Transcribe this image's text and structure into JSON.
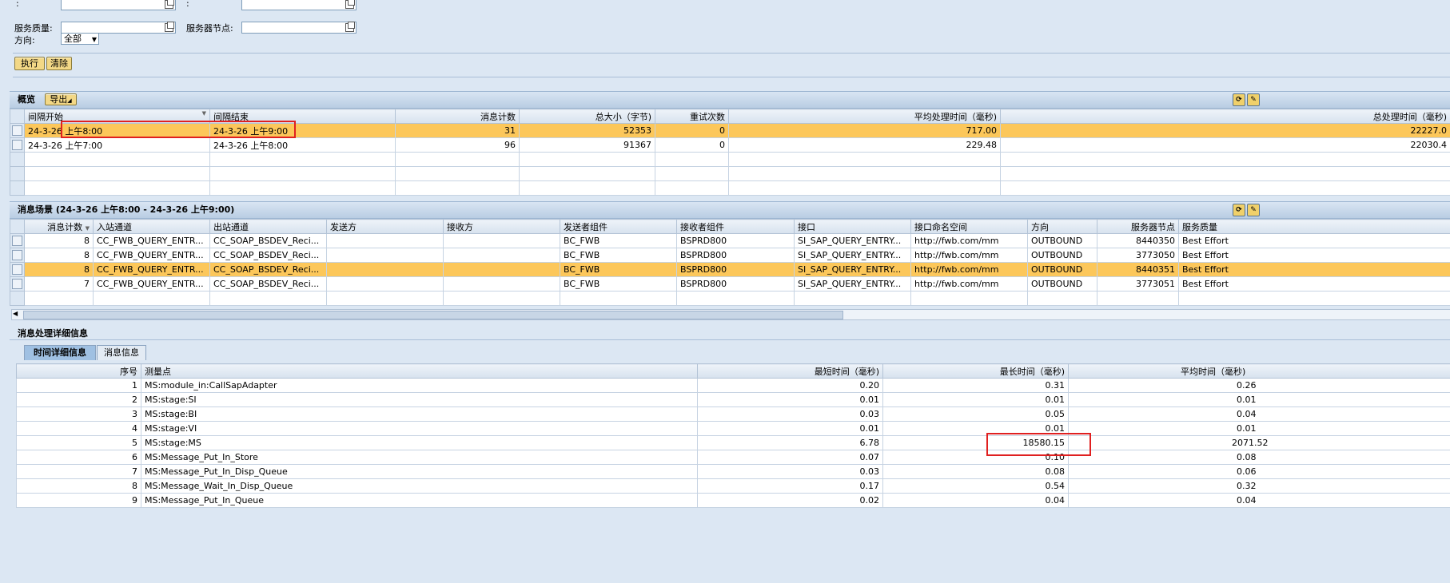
{
  "filter": {
    "row0_label_a": ":",
    "row0_label_b": ":",
    "service_quality_label": "服务质量:",
    "server_node_label": "服务器节点:",
    "direction_label": "方向:",
    "direction_value": "全部",
    "execute_button": "执行",
    "clear_button": "清除"
  },
  "overview": {
    "title": "概览",
    "export_button": "导出",
    "columns": [
      "间隔开始",
      "间隔结束",
      "消息计数",
      "总大小（字节)",
      "重试次数",
      "平均处理时间（毫秒)",
      "总处理时间（毫秒)"
    ],
    "rows": [
      [
        "24-3-26 上午8:00",
        "24-3-26 上午9:00",
        "31",
        "52353",
        "0",
        "717.00",
        "22227.0"
      ],
      [
        "24-3-26 上午7:00",
        "24-3-26 上午8:00",
        "96",
        "91367",
        "0",
        "229.48",
        "22030.4"
      ]
    ]
  },
  "scenario": {
    "title": "消息场景 (24-3-26 上午8:00 - 24-3-26 上午9:00)",
    "columns": [
      "消息计数",
      "入站通道",
      "出站通道",
      "发送方",
      "接收方",
      "发送者组件",
      "接收者组件",
      "接口",
      "接口命名空间",
      "方向",
      "服务器节点",
      "服务质量"
    ],
    "rows": [
      [
        "8",
        "CC_FWB_QUERY_ENTR...",
        "CC_SOAP_BSDEV_Reci...",
        "",
        "",
        "BC_FWB",
        "BSPRD800",
        "SI_SAP_QUERY_ENTRY...",
        "http://fwb.com/mm",
        "OUTBOUND",
        "8440350",
        "Best Effort"
      ],
      [
        "8",
        "CC_FWB_QUERY_ENTR...",
        "CC_SOAP_BSDEV_Reci...",
        "",
        "",
        "BC_FWB",
        "BSPRD800",
        "SI_SAP_QUERY_ENTRY...",
        "http://fwb.com/mm",
        "OUTBOUND",
        "3773050",
        "Best Effort"
      ],
      [
        "8",
        "CC_FWB_QUERY_ENTR...",
        "CC_SOAP_BSDEV_Reci...",
        "",
        "",
        "BC_FWB",
        "BSPRD800",
        "SI_SAP_QUERY_ENTRY...",
        "http://fwb.com/mm",
        "OUTBOUND",
        "8440351",
        "Best Effort"
      ],
      [
        "7",
        "CC_FWB_QUERY_ENTR...",
        "CC_SOAP_BSDEV_Reci...",
        "",
        "",
        "BC_FWB",
        "BSPRD800",
        "SI_SAP_QUERY_ENTRY...",
        "http://fwb.com/mm",
        "OUTBOUND",
        "3773051",
        "Best Effort"
      ]
    ]
  },
  "details": {
    "title": "消息处理详细信息",
    "tabs": [
      "时间详细信息",
      "消息信息"
    ],
    "columns": [
      "序号",
      "测量点",
      "最短时间（毫秒)",
      "最长时间（毫秒)",
      "平均时间（毫秒)"
    ],
    "rows": [
      [
        "1",
        "MS:module_in:CallSapAdapter",
        "0.20",
        "0.31",
        "0.26"
      ],
      [
        "2",
        "MS:stage:SI",
        "0.01",
        "0.01",
        "0.01"
      ],
      [
        "3",
        "MS:stage:BI",
        "0.03",
        "0.05",
        "0.04"
      ],
      [
        "4",
        "MS:stage:VI",
        "0.01",
        "0.01",
        "0.01"
      ],
      [
        "5",
        "MS:stage:MS",
        "6.78",
        "18580.15",
        "2071.52"
      ],
      [
        "6",
        "MS:Message_Put_In_Store",
        "0.07",
        "0.10",
        "0.08"
      ],
      [
        "7",
        "MS:Message_Put_In_Disp_Queue",
        "0.03",
        "0.08",
        "0.06"
      ],
      [
        "8",
        "MS:Message_Wait_In_Disp_Queue",
        "0.17",
        "0.54",
        "0.32"
      ],
      [
        "9",
        "MS:Message_Put_In_Queue",
        "0.02",
        "0.04",
        "0.04"
      ]
    ]
  },
  "colors": {
    "highlight": "#fcc75a",
    "annotation": "#e02020",
    "background": "#dce7f3"
  }
}
